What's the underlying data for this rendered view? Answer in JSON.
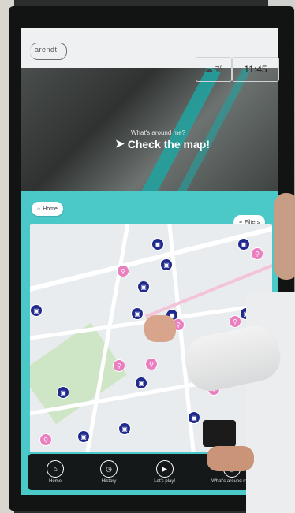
{
  "header": {
    "logo_text": "arendt",
    "temperature": "7°",
    "time": "11:45"
  },
  "hero": {
    "question": "What's around me?",
    "cta": "Check the map!"
  },
  "map_controls": {
    "home_label": "Home",
    "filters_label": "Filters"
  },
  "nav": {
    "items": [
      {
        "label": "Home",
        "icon": "home-icon"
      },
      {
        "label": "History",
        "icon": "history-icon"
      },
      {
        "label": "Let's play!",
        "icon": "play-icon"
      },
      {
        "label": "What's around me?",
        "icon": "around-me-icon"
      }
    ]
  },
  "colors": {
    "accent": "#4bc9c9",
    "marker_blue": "#1f2a8c",
    "marker_pink": "#ea7fc0",
    "navbar": "#151819"
  }
}
